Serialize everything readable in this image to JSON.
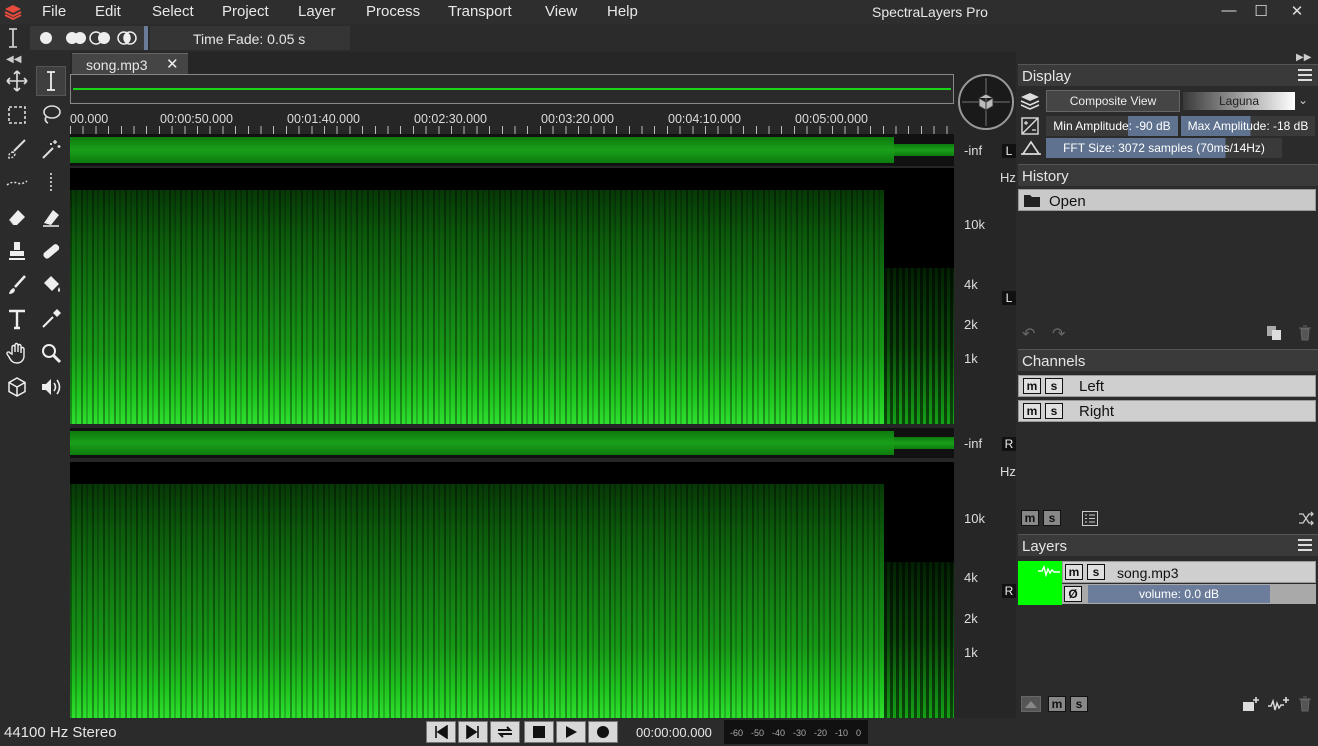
{
  "app": {
    "title": "SpectraLayers Pro"
  },
  "menu": [
    "File",
    "Edit",
    "Select",
    "Project",
    "Layer",
    "Process",
    "Transport",
    "View",
    "Help"
  ],
  "tool_options": {
    "time_fade_label": "Time Fade: 0.05 s"
  },
  "editor": {
    "tab_name": "song.mp3",
    "timeline_labels": [
      "00.000",
      "00:00:50.000",
      "00:01:40.000",
      "00:02:30.000",
      "00:03:20.000",
      "00:04:10.000",
      "00:05:00.000"
    ],
    "level_label": "-inf",
    "freq_unit": "Hz",
    "freq_labels": [
      "10k",
      "4k",
      "2k",
      "1k"
    ],
    "channel_left": "L",
    "channel_right": "R"
  },
  "display": {
    "title": "Display",
    "composite_view": "Composite View",
    "palette": "Laguna",
    "min_amplitude": "Min Amplitude: -90 dB",
    "max_amplitude": "Max Amplitude: -18 dB",
    "fft_size": "FFT Size: 3072 samples (70ms/14Hz)"
  },
  "history": {
    "title": "History",
    "items": [
      "Open"
    ]
  },
  "channels": {
    "title": "Channels",
    "items": [
      "Left",
      "Right"
    ],
    "mute": "m",
    "solo": "s"
  },
  "layers": {
    "title": "Layers",
    "items": [
      {
        "name": "song.mp3",
        "volume": "volume: 0.0 dB"
      }
    ]
  },
  "status": {
    "sample_rate": "44100 Hz Stereo",
    "timecode": "00:00:00.000",
    "meter_labels": [
      "-60",
      "-50",
      "-40",
      "-30",
      "-20",
      "-10",
      "0"
    ]
  }
}
